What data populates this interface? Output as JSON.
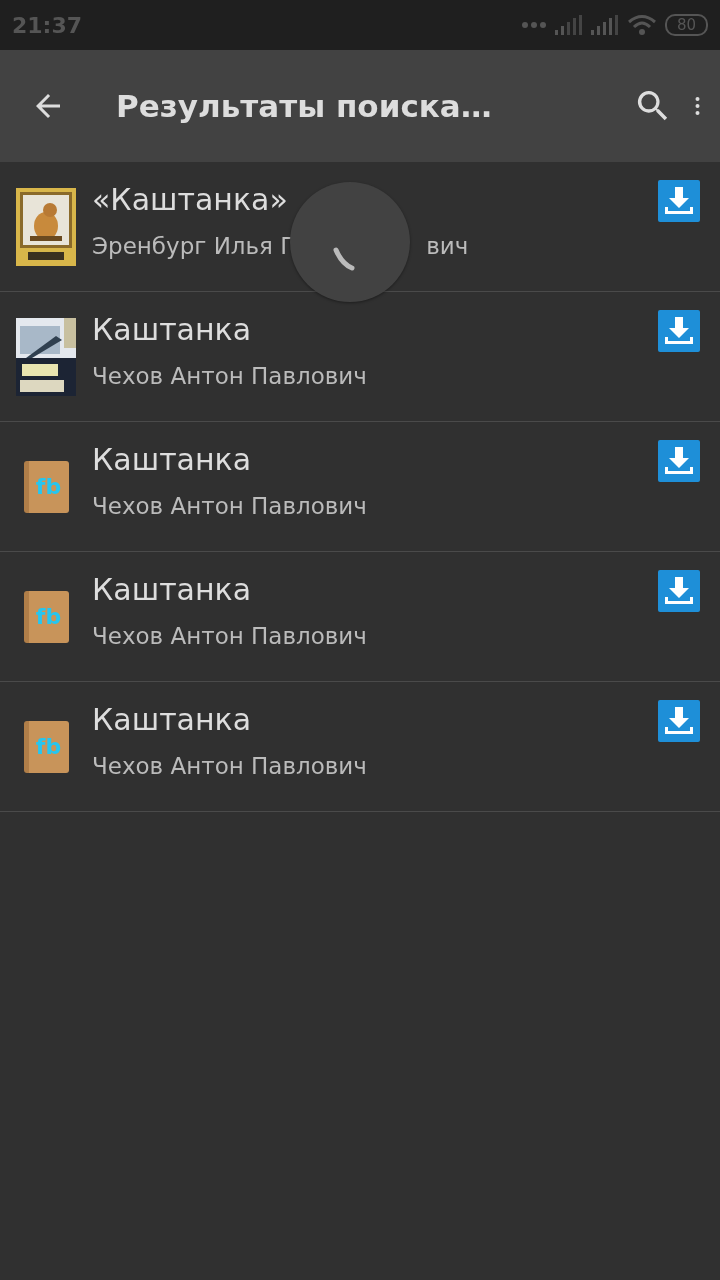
{
  "status_bar": {
    "time": "21:37",
    "battery": "80"
  },
  "toolbar": {
    "title": "Результаты поиска…"
  },
  "loading": true,
  "results": [
    {
      "kind": "picture",
      "title": "«Каштанка»",
      "author_parts": [
        "Эренбург Илья Г",
        "вич"
      ]
    },
    {
      "kind": "picture",
      "title": "Каштанка",
      "author_parts": [
        "Чехов Антон Павлович"
      ]
    },
    {
      "kind": "book",
      "badge": "fb",
      "title": "Каштанка",
      "author_parts": [
        "Чехов Антон Павлович"
      ]
    },
    {
      "kind": "book",
      "badge": "fb",
      "title": "Каштанка",
      "author_parts": [
        "Чехов Антон Павлович"
      ]
    },
    {
      "kind": "book",
      "badge": "fb",
      "title": "Каштанка",
      "author_parts": [
        "Чехов Антон Павлович"
      ]
    }
  ]
}
